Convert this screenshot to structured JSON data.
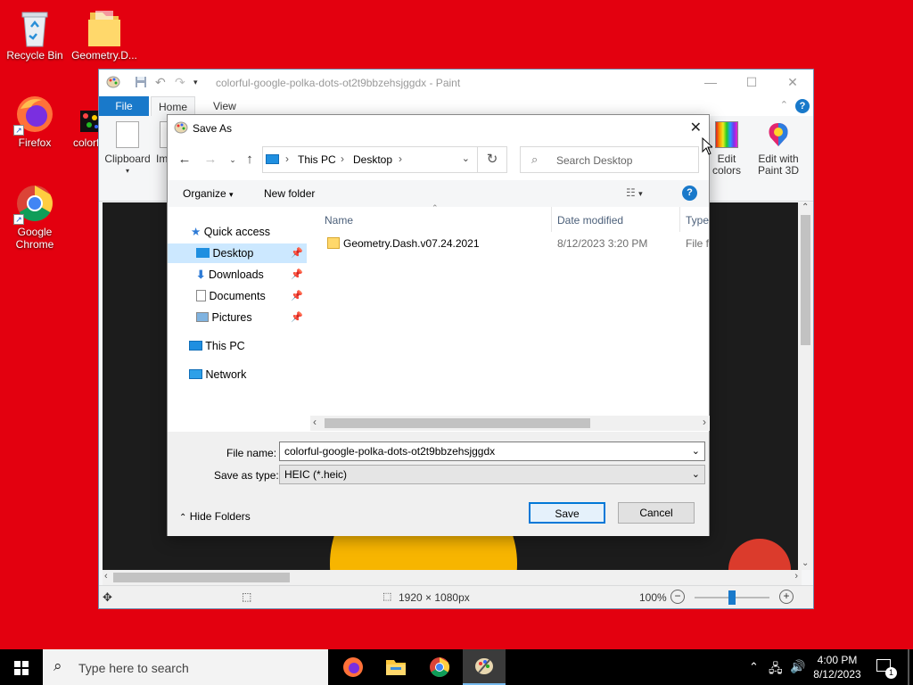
{
  "desktop": {
    "icons": [
      {
        "label": "Recycle Bin"
      },
      {
        "label": "Geometry.D..."
      },
      {
        "label": "Firefox"
      },
      {
        "label": "colorf"
      },
      {
        "label": "Google Chrome"
      }
    ]
  },
  "paint": {
    "title": "colorful-google-polka-dots-ot2t9bbzehsjggdx - Paint",
    "menu": {
      "file": "File",
      "home": "Home",
      "view": "View"
    },
    "ribbon": {
      "clipboard": "Clipboard",
      "image_partial": "Im",
      "edit_colors": "Edit colors",
      "edit_paint3d": "Edit with Paint 3D"
    },
    "status": {
      "dimensions": "1920 × 1080px",
      "zoom": "100%"
    }
  },
  "dialog": {
    "title": "Save As",
    "breadcrumb": [
      "This PC",
      "Desktop"
    ],
    "search_placeholder": "Search Desktop",
    "toolbar": {
      "organize": "Organize",
      "new_folder": "New folder"
    },
    "nav": {
      "quick_access": "Quick access",
      "desktop": "Desktop",
      "downloads": "Downloads",
      "documents": "Documents",
      "pictures": "Pictures",
      "this_pc": "This PC",
      "network": "Network"
    },
    "columns": {
      "name": "Name",
      "date": "Date modified",
      "type": "Type"
    },
    "files": [
      {
        "name": "Geometry.Dash.v07.24.2021",
        "date": "8/12/2023 3:20 PM",
        "type": "File fo"
      }
    ],
    "file_name_label": "File name:",
    "file_name": "colorful-google-polka-dots-ot2t9bbzehsjggdx",
    "save_type_label": "Save as type:",
    "save_type": "HEIC (*.heic)",
    "hide_folders": "Hide Folders",
    "save": "Save",
    "cancel": "Cancel"
  },
  "taskbar": {
    "search_placeholder": "Type here to search",
    "time": "4:00 PM",
    "date": "8/12/2023",
    "notification_count": "1"
  },
  "colors": {
    "desktop_bg": "#e3000f",
    "accent": "#0078d7"
  }
}
